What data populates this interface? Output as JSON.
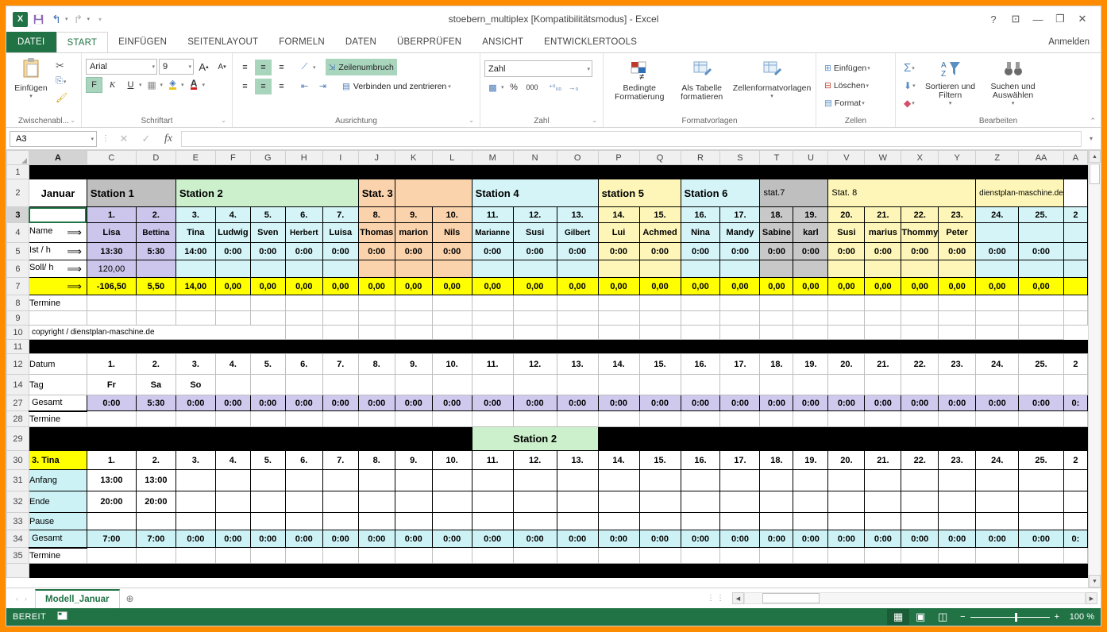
{
  "window": {
    "title": "stoebern_multiplex [Kompatibilitätsmodus] - Excel",
    "help": "?",
    "ribbon_display": "⊡",
    "minimize": "—",
    "restore": "❐",
    "close": "✕",
    "signin": "Anmelden"
  },
  "quick_access": {
    "logo": "X",
    "save": "save-icon",
    "undo": "↰",
    "redo": "↱",
    "more": "▾"
  },
  "tabs": [
    {
      "label": "DATEI",
      "active": false,
      "file": true
    },
    {
      "label": "START",
      "active": true
    },
    {
      "label": "EINFÜGEN",
      "active": false
    },
    {
      "label": "SEITENLAYOUT",
      "active": false
    },
    {
      "label": "FORMELN",
      "active": false
    },
    {
      "label": "DATEN",
      "active": false
    },
    {
      "label": "ÜBERPRÜFEN",
      "active": false
    },
    {
      "label": "ANSICHT",
      "active": false
    },
    {
      "label": "ENTWICKLERTOOLS",
      "active": false
    }
  ],
  "ribbon": {
    "groups": [
      {
        "title": "Zwischenabl...",
        "dialog": "⌄"
      },
      {
        "title": "Schriftart",
        "dialog": "⌄"
      },
      {
        "title": "Ausrichtung",
        "dialog": "⌄"
      },
      {
        "title": "Zahl",
        "dialog": "⌄"
      },
      {
        "title": "Formatvorlagen",
        "dialog": ""
      },
      {
        "title": "Zellen",
        "dialog": ""
      },
      {
        "title": "Bearbeiten",
        "dialog": ""
      }
    ],
    "clipboard": {
      "paste": "Einfügen",
      "cut": "✄",
      "copy": "❐",
      "format_painter": "🖌"
    },
    "font": {
      "name": "Arial",
      "size": "9",
      "grow": "A",
      "shrink": "A",
      "bold": "F",
      "italic": "K",
      "underline": "U",
      "borders": "▦",
      "fill": "▲",
      "color": "A"
    },
    "alignment": {
      "wrap": "Zeilenumbruch",
      "merge": "Verbinden und zentrieren",
      "orientation": "⟋",
      "indent_dec": "⇤",
      "indent_inc": "⇥"
    },
    "number": {
      "format": "Zahl",
      "currency": "▦",
      "percent": "%",
      "thousands": "000",
      "inc_dec": "⁺⁰₀₀",
      "dec_dec": "⁻⁰₀₀"
    },
    "styles": {
      "conditional": "Bedingte Formatierung",
      "table": "Als Tabelle formatieren",
      "cellstyles": "Zellenformatvorlagen"
    },
    "cells": {
      "insert": "Einfügen",
      "delete": "Löschen",
      "format": "Format"
    },
    "editing": {
      "autosum": "Σ",
      "fill": "⬇",
      "clear": "◆",
      "sort": "Sortieren und Filtern",
      "find": "Suchen und Auswählen"
    },
    "collapse": "⌃"
  },
  "formula_bar": {
    "name_box": "A3",
    "cancel": "✕",
    "confirm": "✓",
    "fx": "fx",
    "value": "",
    "expand": "▾"
  },
  "grid": {
    "columns": [
      "A",
      "C",
      "D",
      "E",
      "F",
      "G",
      "H",
      "I",
      "J",
      "K",
      "L",
      "M",
      "N",
      "O",
      "P",
      "Q",
      "R",
      "S",
      "T",
      "U",
      "V",
      "W",
      "X",
      "Y",
      "Z",
      "AA",
      "A"
    ],
    "selected_column": "A",
    "selected_cell": "A3",
    "rows": [
      "1",
      "2",
      "3",
      "4",
      "5",
      "6",
      "7",
      "8",
      "9",
      "10",
      "11",
      "12",
      "14",
      "27",
      "28",
      "29",
      "30",
      "31",
      "32",
      "33",
      "34",
      "35"
    ],
    "selected_row": "3",
    "stations_row2": [
      {
        "label": "Januar",
        "fill": "white",
        "span": 1,
        "red": true
      },
      {
        "label": "Station 1",
        "fill": "grey",
        "span": 2
      },
      {
        "label": "Station 2",
        "fill": "green",
        "span": 5
      },
      {
        "label": "Stat. 3",
        "fill": "orange",
        "span": 1
      },
      {
        "label": "",
        "fill": "orange",
        "span": 2
      },
      {
        "label": "Station 4",
        "fill": "cyan",
        "span": 3
      },
      {
        "label": "station 5",
        "fill": "lyel",
        "span": 2
      },
      {
        "label": "Station 6",
        "fill": "cyan",
        "span": 2
      },
      {
        "label": "stat.7",
        "fill": "grey",
        "span": 2
      },
      {
        "label": "Stat. 8",
        "fill": "lyel",
        "span": 4
      },
      {
        "label": "dienstplan-maschine.de",
        "fill": "lyel",
        "span": 2
      },
      {
        "label": "",
        "fill": "white",
        "span": 3
      }
    ],
    "numbers_row3": [
      "1.",
      "2.",
      "3.",
      "4.",
      "5.",
      "6.",
      "7.",
      "8.",
      "9.",
      "10.",
      "11.",
      "12.",
      "13.",
      "14.",
      "15.",
      "16.",
      "17.",
      "18.",
      "19.",
      "20.",
      "21.",
      "22.",
      "23.",
      "24.",
      "25.",
      "2"
    ],
    "row_labels": {
      "name": "Name",
      "ist": "Ist / h",
      "soll": "Soll/ h",
      "arrow": "⟹",
      "termine": "Termine",
      "copyright": "copyright / dienstplan-maschine.de",
      "datum": "Datum",
      "tag": "Tag",
      "gesamt": "Gesamt",
      "person": "3. Tina",
      "anfang": "Anfang",
      "ende": "Ende",
      "pause": "Pause"
    },
    "names_row4": [
      "Lisa",
      "Bettina",
      "Tina",
      "Ludwig",
      "Sven",
      "Herbert",
      "Luisa",
      "Thomas",
      "marion",
      "Nils",
      "Marianne",
      "Susi",
      "Gilbert",
      "Lui",
      "Achmed",
      "Nina",
      "Mandy",
      "Sabine",
      "karl",
      "Susi",
      "marius",
      "Thommy",
      "Peter",
      "",
      "",
      ""
    ],
    "ist_row5": [
      "13:30",
      "5:30",
      "14:00",
      "0:00",
      "0:00",
      "0:00",
      "0:00",
      "0:00",
      "0:00",
      "0:00",
      "0:00",
      "0:00",
      "0:00",
      "0:00",
      "0:00",
      "0:00",
      "0:00",
      "0:00",
      "0:00",
      "0:00",
      "0:00",
      "0:00",
      "0:00",
      "0:00",
      "0:00",
      ""
    ],
    "soll_row6": [
      "120,00",
      "",
      "",
      "",
      "",
      "",
      "",
      "",
      "",
      "",
      "",
      "",
      "",
      "",
      "",
      "",
      "",
      "",
      "",
      "",
      "",
      "",
      "",
      "",
      "",
      ""
    ],
    "diff_row7": [
      "-106,50",
      "5,50",
      "14,00",
      "0,00",
      "0,00",
      "0,00",
      "0,00",
      "0,00",
      "0,00",
      "0,00",
      "0,00",
      "0,00",
      "0,00",
      "0,00",
      "0,00",
      "0,00",
      "0,00",
      "0,00",
      "0,00",
      "0,00",
      "0,00",
      "0,00",
      "0,00",
      "0,00",
      "0,00",
      ""
    ],
    "datum_row12": [
      "1.",
      "2.",
      "3.",
      "4.",
      "5.",
      "6.",
      "7.",
      "8.",
      "9.",
      "10.",
      "11.",
      "12.",
      "13.",
      "14.",
      "15.",
      "16.",
      "17.",
      "18.",
      "19.",
      "20.",
      "21.",
      "22.",
      "23.",
      "24.",
      "25.",
      "2"
    ],
    "datum_red": [
      true,
      true,
      true,
      false,
      false,
      false,
      false,
      false,
      true,
      true,
      false,
      false,
      false,
      false,
      false,
      true,
      true,
      false,
      false,
      false,
      false,
      false,
      true,
      true,
      false,
      false
    ],
    "tag_row14": [
      "Fr",
      "Sa",
      "So",
      "",
      "",
      "",
      "",
      "",
      "",
      "",
      "",
      "",
      "",
      "",
      "",
      "",
      "",
      "",
      "",
      "",
      "",
      "",
      "",
      "",
      "",
      ""
    ],
    "gesamt_row27": [
      "0:00",
      "5:30",
      "0:00",
      "0:00",
      "0:00",
      "0:00",
      "0:00",
      "0:00",
      "0:00",
      "0:00",
      "0:00",
      "0:00",
      "0:00",
      "0:00",
      "0:00",
      "0:00",
      "0:00",
      "0:00",
      "0:00",
      "0:00",
      "0:00",
      "0:00",
      "0:00",
      "0:00",
      "0:00",
      "0:"
    ],
    "row29_station": "Station 2",
    "datum_row30": [
      "1.",
      "2.",
      "3.",
      "4.",
      "5.",
      "6.",
      "7.",
      "8.",
      "9.",
      "10.",
      "11.",
      "12.",
      "13.",
      "14.",
      "15.",
      "16.",
      "17.",
      "18.",
      "19.",
      "20.",
      "21.",
      "22.",
      "23.",
      "24.",
      "25.",
      "2"
    ],
    "anfang_row31": [
      "13:00",
      "13:00",
      "",
      "",
      "",
      "",
      "",
      "",
      "",
      "",
      "",
      "",
      "",
      "",
      "",
      "",
      "",
      "",
      "",
      "",
      "",
      "",
      "",
      "",
      "",
      ""
    ],
    "ende_row32": [
      "20:00",
      "20:00",
      "",
      "",
      "",
      "",
      "",
      "",
      "",
      "",
      "",
      "",
      "",
      "",
      "",
      "",
      "",
      "",
      "",
      "",
      "",
      "",
      "",
      "",
      "",
      ""
    ],
    "pause_row33": [
      "",
      "",
      "",
      "",
      "",
      "",
      "",
      "",
      "",
      "",
      "",
      "",
      "",
      "",
      "",
      "",
      "",
      "",
      "",
      "",
      "",
      "",
      "",
      "",
      "",
      ""
    ],
    "gesamt_row34": [
      "7:00",
      "7:00",
      "0:00",
      "0:00",
      "0:00",
      "0:00",
      "0:00",
      "0:00",
      "0:00",
      "0:00",
      "0:00",
      "0:00",
      "0:00",
      "0:00",
      "0:00",
      "0:00",
      "0:00",
      "0:00",
      "0:00",
      "0:00",
      "0:00",
      "0:00",
      "0:00",
      "0:00",
      "0:00",
      "0:"
    ]
  },
  "sheet_tabs": {
    "prev": "‹",
    "next": "›",
    "tabs": [
      {
        "label": "Modell_Januar",
        "active": true
      }
    ],
    "add": "⊕"
  },
  "status_bar": {
    "mode": "BEREIT",
    "macro_icon": "record-macro-icon",
    "views": [
      "normal-view-icon",
      "page-layout-icon",
      "page-break-icon"
    ],
    "zoom_out": "−",
    "zoom_in": "+",
    "zoom_level": "100 %"
  },
  "colors": {
    "accent_green": "#217346",
    "window_border_orange": "#ff8c00",
    "header_red": "#cc0000",
    "yellow": "#ffff00"
  }
}
